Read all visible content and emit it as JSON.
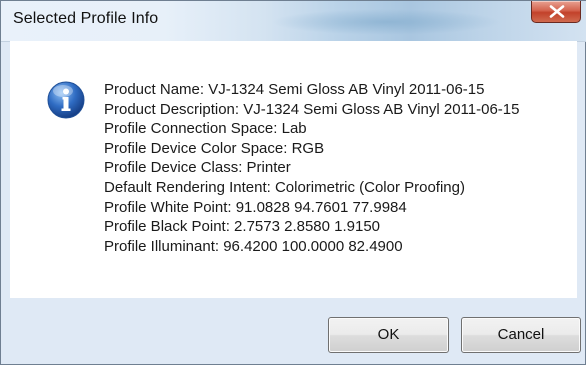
{
  "window": {
    "title": "Selected Profile Info",
    "close_icon": "close-icon"
  },
  "message": {
    "icon": "info-icon",
    "lines": [
      "Product Name: VJ-1324 Semi Gloss AB Vinyl 2011-06-15",
      "Product Description: VJ-1324 Semi Gloss AB Vinyl 2011-06-15",
      "Profile Connection Space: Lab",
      "Profile Device Color Space: RGB",
      "Profile Device Class: Printer",
      "Default Rendering Intent: Colorimetric (Color Proofing)",
      "Profile White Point: 91.0828  94.7601  77.9984",
      "Profile Black Point: 2.7573  2.8580  1.9150",
      "Profile Illuminant: 96.4200  100.0000  82.4900"
    ]
  },
  "buttons": {
    "ok_label": "OK",
    "cancel_label": "Cancel"
  },
  "colors": {
    "close_button": "#c2412a",
    "info_icon": "#2f6cc3",
    "dialog_frame": "#dfe9f5"
  }
}
